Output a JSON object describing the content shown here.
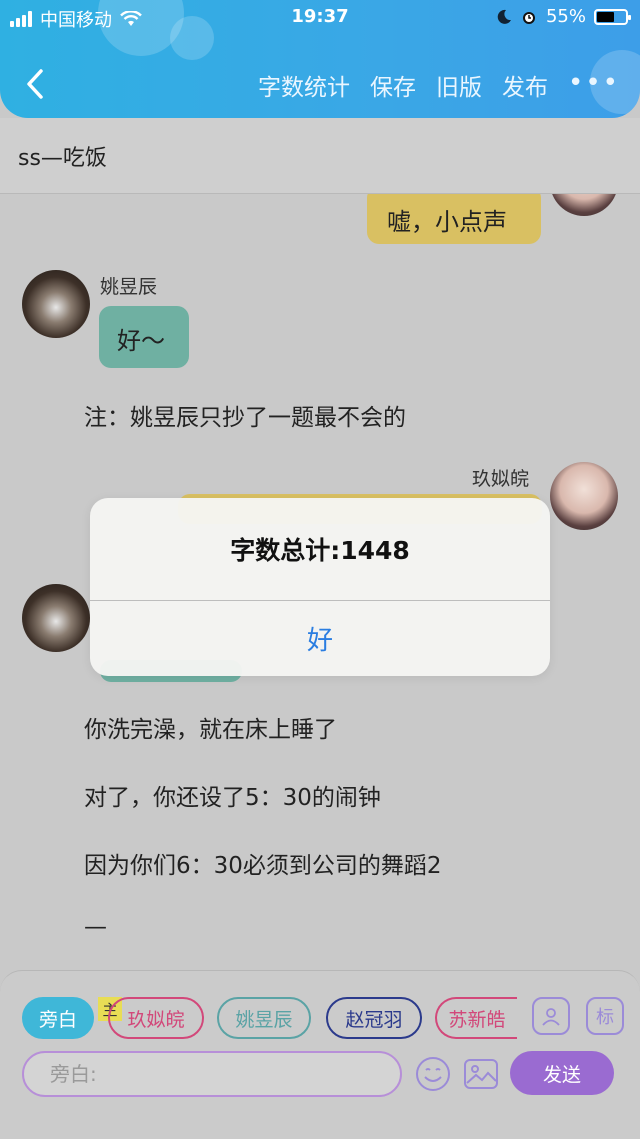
{
  "status_bar": {
    "carrier": "中国移动",
    "time": "19:37",
    "battery": "55%",
    "battery_level": 0.55
  },
  "header": {
    "actions": [
      "字数统计",
      "保存",
      "旧版",
      "发布"
    ],
    "more": "•••"
  },
  "title": "ss—吃饭",
  "chat": {
    "msg1": {
      "text": "嘘，小点声"
    },
    "msg2": {
      "name": "姚昱辰",
      "text": "好～"
    },
    "note1": "注：姚昱辰只抄了一题最不会的",
    "msg3": {
      "name": "玖姒皖"
    },
    "narr1": "你洗完澡，就在床上睡了",
    "narr2": "对了，你还设了5：30的闹钟",
    "narr3": "因为你们6：30必须到公司的舞蹈2",
    "narr4": "—"
  },
  "dialog": {
    "message": "字数总计:1448",
    "ok": "好"
  },
  "composer": {
    "chips": [
      "旁白",
      "玖姒皖",
      "姚昱辰",
      "赵冠羽",
      "苏新皓"
    ],
    "host_tag": "主",
    "label_button": "标",
    "input_placeholder": "旁白:",
    "send": "发送",
    "colors": {
      "narrator": "#3fb7d8",
      "jiu": "#d2487a",
      "yao": "#5aa3a5",
      "zhao": "#2b3a8c",
      "su": "#d2487a"
    }
  }
}
